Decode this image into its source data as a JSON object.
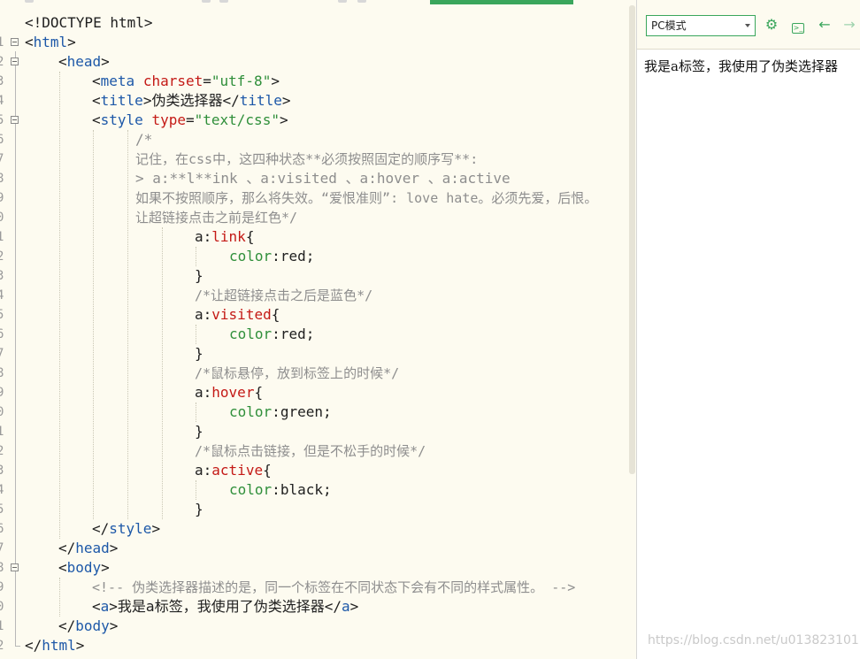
{
  "editor": {
    "line_numbers": [
      "1",
      "2",
      "3",
      "4",
      "5",
      "6",
      "7",
      "8",
      "9",
      "0",
      "1",
      "2",
      "3",
      "4",
      "5",
      "6",
      "7",
      "8",
      "9",
      "0",
      "1",
      "2",
      "3",
      "4",
      "5",
      "6",
      "7",
      "8",
      "9",
      "0",
      "1",
      "2",
      "3"
    ],
    "code": {
      "doctype": "<!DOCTYPE html>",
      "html_open_lt": "<",
      "html_open_name": "html",
      "html_open_gt": ">",
      "head_open_lt": "<",
      "head_open_name": "head",
      "head_open_gt": ">",
      "meta_lt": "<",
      "meta_name": "meta",
      "meta_attr": "charset",
      "meta_eq": "=",
      "meta_val": "\"utf-8\"",
      "meta_gt": ">",
      "title_open": "<",
      "title_name": "title",
      "title_gt": ">",
      "title_text": "伪类选择器",
      "title_close_lt": "</",
      "title_close_name": "title",
      "title_close_gt": ">",
      "style_lt": "<",
      "style_name": "style",
      "style_attr": "type",
      "style_eq": "=",
      "style_val": "\"text/css\"",
      "style_gt": ">",
      "comment_1": "/*",
      "comment_2": "记住，在css中，这四种状态**必须按照固定的顺序写**:",
      "comment_3": "> a:**l**ink 、a:visited 、a:hover 、a:active",
      "comment_4": "如果不按照顺序，那么将失效。“爱恨准则”: love hate。必须先爱，后恨。",
      "comment_5": "让超链接点击之前是红色*/",
      "sel_link_a": "a",
      "sel_link_colon": ":",
      "sel_link_pseudo": "link",
      "sel_link_brace": "{",
      "prop_1": "color",
      "prop_1_colon": ":",
      "val_1": "red;",
      "close_brace_1": "}",
      "comment_visited": "/*让超链接点击之后是蓝色*/",
      "sel_visited_a": "a",
      "sel_visited_colon": ":",
      "sel_visited_pseudo": "visited",
      "sel_visited_brace": "{",
      "prop_2": "color",
      "prop_2_colon": ":",
      "val_2": "red;",
      "close_brace_2": "}",
      "comment_hover": "/*鼠标悬停，放到标签上的时候*/",
      "sel_hover_a": "a",
      "sel_hover_colon": ":",
      "sel_hover_pseudo": "hover",
      "sel_hover_brace": "{",
      "prop_3": "color",
      "prop_3_colon": ":",
      "val_3": "green;",
      "close_brace_3": "}",
      "comment_active": "/*鼠标点击链接，但是不松手的时候*/",
      "sel_active_a": "a",
      "sel_active_colon": ":",
      "sel_active_pseudo": "active",
      "sel_active_brace": "{",
      "prop_4": "color",
      "prop_4_colon": ":",
      "val_4": "black;",
      "close_brace_4": "}",
      "style_close_lt": "</",
      "style_close_name": "style",
      "style_close_gt": ">",
      "head_close_lt": "</",
      "head_close_name": "head",
      "head_close_gt": ">",
      "body_open_lt": "<",
      "body_open_name": "body",
      "body_open_gt": ">",
      "body_comment": "<!-- 伪类选择器描述的是，同一个标签在不同状态下会有不同的样式属性。 -->",
      "a_open_lt": "<",
      "a_open_name": "a",
      "a_open_gt": ">",
      "a_text": "我是a标签，我使用了伪类选择器",
      "a_close_lt": "</",
      "a_close_name": "a",
      "a_close_gt": ">",
      "body_close_lt": "</",
      "body_close_name": "body",
      "body_close_gt": ">",
      "html_close_lt": "</",
      "html_close_name": "html",
      "html_close_gt": ">"
    }
  },
  "preview": {
    "mode_select_value": "PC模式",
    "icons": [
      "gear-icon",
      "console-icon",
      "arrow-left-icon",
      "arrow-right-icon"
    ],
    "content_text": "我是a标签，我使用了伪类选择器",
    "watermark": "https://blog.csdn.net/u013823101"
  },
  "colors": {
    "tag": "#1d58a8",
    "attribute": "#c41a16",
    "string": "#2f8f3a",
    "comment": "#8e8e8e",
    "accent_green": "#3aa65c"
  }
}
